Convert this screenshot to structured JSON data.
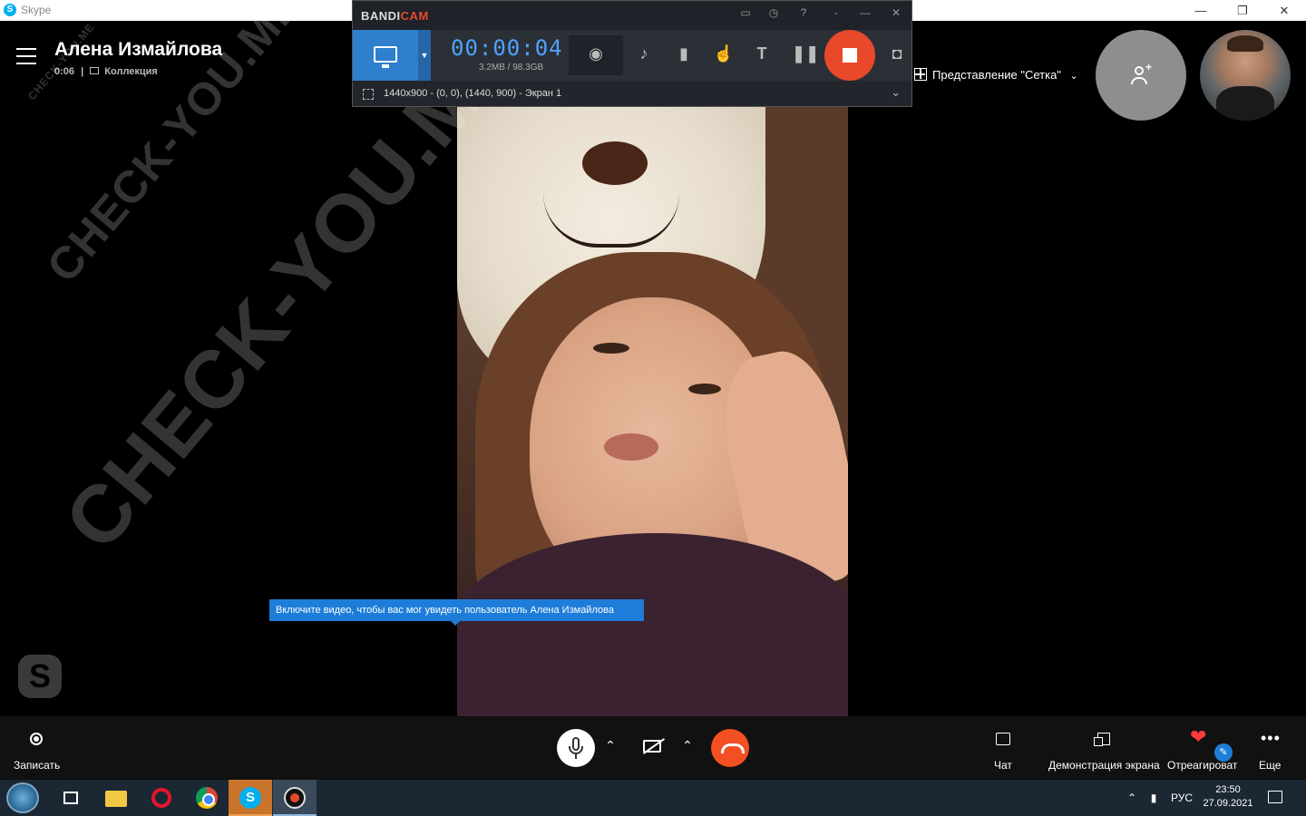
{
  "window": {
    "app_title": "Skype",
    "minimize": "—",
    "maximize": "❐",
    "close": "✕"
  },
  "call": {
    "contact_name": "Алена Измайлова",
    "duration": "0:06",
    "separator": "|",
    "collection_icon": "gallery-icon",
    "collection_label": "Коллекция"
  },
  "watermark": {
    "text": "CHECK-YOU.ME"
  },
  "bandicam": {
    "logo_part1": "BANDI",
    "logo_part2": "CAM",
    "timer": "00:00:04",
    "file_size": "3.2MB / 98.3GB",
    "region": "1440x900 - (0, 0), (1440, 900) - Экран 1",
    "top_icons": [
      "folder-icon",
      "history-icon",
      "help-icon",
      "minimize-icon",
      "maximize-icon",
      "close-icon"
    ],
    "toolbar_icons": [
      "webcam-icon",
      "speaker-icon",
      "microphone-icon",
      "cursor-icon",
      "text-icon",
      "pause-icon",
      "stop-icon",
      "camera-icon"
    ]
  },
  "view": {
    "grid_label": "Представление \"Сетка\"",
    "grid_chevron": "⌄"
  },
  "tooltip": {
    "text": "Включите видео, чтобы вас мог увидеть пользователь Алена Измайлова"
  },
  "controls": {
    "record_label": "Записать",
    "chat_label": "Чат",
    "share_label": "Демонстрация экрана",
    "react_label": "Отреагироват",
    "more_label": "Еще",
    "more_glyph": "•••",
    "chevron": "⌃"
  },
  "taskbar": {
    "items": [
      "start-icon",
      "task-view-icon",
      "explorer-icon",
      "opera-icon",
      "chrome-icon",
      "skype-icon",
      "bandicam-icon"
    ],
    "skype_glyph": "S",
    "language": "РУС",
    "time": "23:50",
    "date": "27.09.2021",
    "tray_up": "⌃"
  },
  "colors": {
    "skype_blue": "#00aff0",
    "end_call_red": "#f25022",
    "bandicam_red": "#e8492b",
    "tooltip_blue": "#1e7dd8",
    "timer_blue": "#4fa3ff"
  }
}
